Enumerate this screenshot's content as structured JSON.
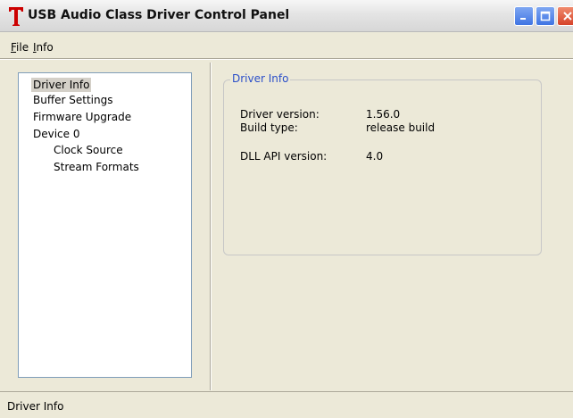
{
  "window": {
    "title": "USB Audio Class Driver Control Panel",
    "app_icon_glyph": "T",
    "app_icon_color": "#cc0000"
  },
  "menu": {
    "file_label": "File",
    "file_accel": "F",
    "file_rest": "ile",
    "info_label": "Info",
    "info_accel": "I",
    "info_rest": "nfo"
  },
  "tree": {
    "items": [
      {
        "label": "Driver Info",
        "selected": true
      },
      {
        "label": "Buffer Settings"
      },
      {
        "label": "Firmware Upgrade"
      },
      {
        "label": "Device 0"
      },
      {
        "label": "Clock Source"
      },
      {
        "label": "Stream Formats"
      }
    ]
  },
  "panel": {
    "group_title": "Driver Info",
    "rows": [
      {
        "label": "Driver version:",
        "value": "1.56.0"
      },
      {
        "label": "Build type:",
        "value": "release build"
      },
      {
        "label": "DLL API version:",
        "value": "4.0"
      }
    ]
  },
  "status": {
    "text": "Driver Info"
  },
  "colors": {
    "accent": "#2b4fc9",
    "window_bg": "#ece9d8"
  }
}
